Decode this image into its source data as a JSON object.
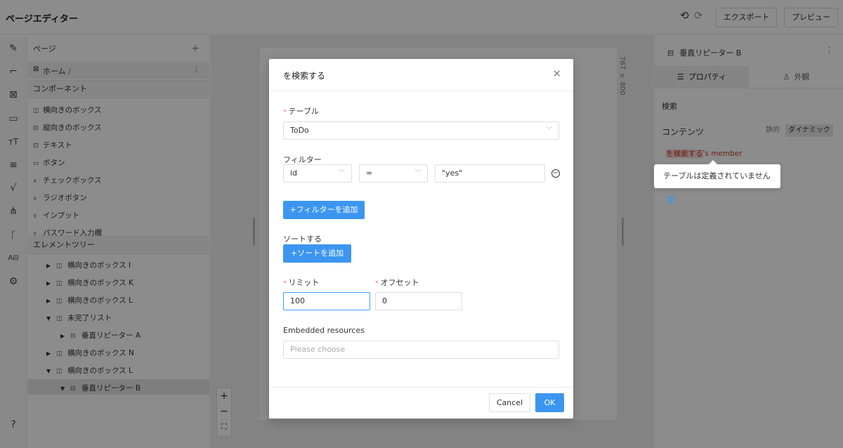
{
  "header": {
    "title": "ページエディター",
    "export_label": "エクスポート",
    "preview_label": "プレビュー"
  },
  "left_panel": {
    "pages_title": "ページ",
    "home_label": "ホーム",
    "home_path": "/",
    "components_title": "コンポーネント",
    "components": [
      {
        "icon": "horizontal-box-icon",
        "label": "横向きのボックス"
      },
      {
        "icon": "vertical-box-icon",
        "label": "縦向きのボックス"
      },
      {
        "icon": "text-icon",
        "label": "テキスト"
      },
      {
        "icon": "button-icon",
        "label": "ボタン"
      },
      {
        "icon": "checkbox-icon",
        "label": "チェックボックス"
      },
      {
        "icon": "radio-icon",
        "label": "ラジオボタン"
      },
      {
        "icon": "input-icon",
        "label": "インプット"
      },
      {
        "icon": "password-icon",
        "label": "パスワード入力欄"
      }
    ],
    "tree_title": "エレメントツリー",
    "tree": [
      {
        "label": "横向きのボックス I",
        "level": 1,
        "expanded": false
      },
      {
        "label": "横向きのボックス K",
        "level": 1,
        "expanded": false
      },
      {
        "label": "横向きのボックス L",
        "level": 1,
        "expanded": false
      },
      {
        "label": "未完了リスト",
        "level": 1,
        "expanded": true
      },
      {
        "label": "垂直リピーター A",
        "level": 2,
        "expanded": false
      },
      {
        "label": "横向きのボックス N",
        "level": 1,
        "expanded": false
      },
      {
        "label": "横向きのボックス L",
        "level": 1,
        "expanded": true
      },
      {
        "label": "垂直リピーター B",
        "level": 2,
        "expanded": true,
        "selected": true
      }
    ]
  },
  "canvas": {
    "dimensions": "767 × 800"
  },
  "right_panel": {
    "title": "垂直リピーター B",
    "tab_properties": "プロパティ",
    "tab_appearance": "外観",
    "search_label": "検索",
    "content_label": "コンテンツ",
    "static_label": "静的",
    "dynamic_label": "ダイナミック",
    "binding_highlight": "を検索する",
    "binding_suffix": "'s member"
  },
  "tooltip": {
    "text": "テーブルは定義されていません"
  },
  "modal": {
    "title": "を検索する",
    "table_label": "テーブル",
    "table_value": "ToDo",
    "filter_label": "フィルター",
    "filter_field": "id",
    "filter_operator": "=",
    "filter_value": "\"yes\"",
    "add_filter_label": "+フィルターを追加",
    "sort_label": "ソートする",
    "add_sort_label": "+ソートを追加",
    "limit_label": "リミット",
    "limit_value": "100",
    "offset_label": "オフセット",
    "offset_value": "0",
    "embedded_label": "Embedded resources",
    "embedded_placeholder": "Please choose",
    "cancel_label": "Cancel",
    "ok_label": "OK"
  },
  "colors": {
    "primary": "#3c96f0",
    "required": "#f56c6c",
    "binding": "#c0392b"
  }
}
